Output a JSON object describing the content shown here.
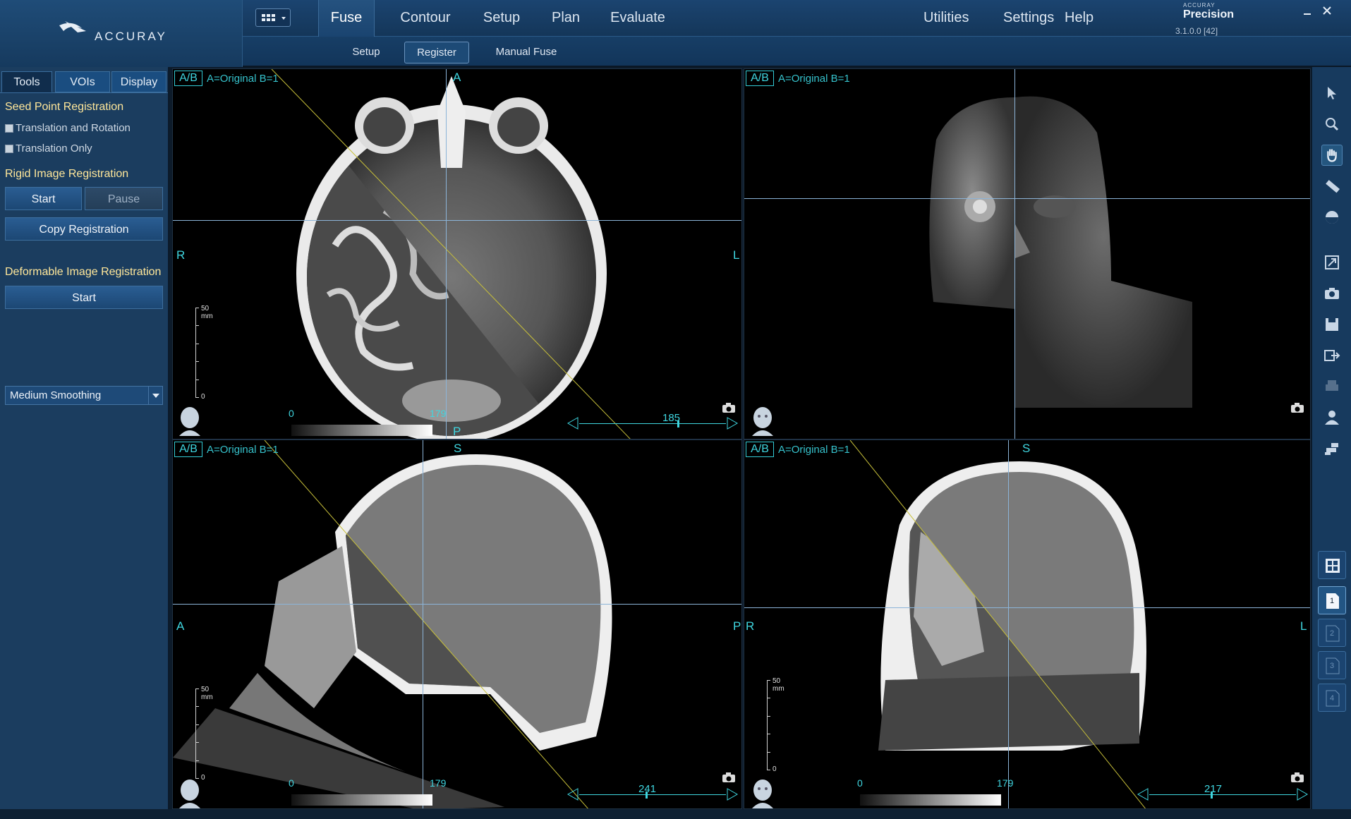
{
  "brand": {
    "logo_text": "ACCURAY",
    "small": "ACCURAY",
    "product": "Precision",
    "version": "3.1.0.0 [42]"
  },
  "main_tabs": [
    "Fuse",
    "Contour",
    "Setup",
    "Plan",
    "Evaluate"
  ],
  "util_tabs": [
    "Utilities",
    "Settings",
    "Help"
  ],
  "sub_tabs": [
    "Setup",
    "Register",
    "Manual Fuse"
  ],
  "left_panel": {
    "tabs": [
      "Tools",
      "VOIs",
      "Display"
    ],
    "seed_title": "Seed Point Registration",
    "check_translation_rotation": "Translation and Rotation",
    "check_translation_only": "Translation Only",
    "rigid_title": "Rigid Image Registration",
    "start_label": "Start",
    "pause_label": "Pause",
    "copy_label": "Copy Registration",
    "deformable_title": "Deformable Image Registration",
    "deformable_start_label": "Start",
    "smoothing_value": "Medium Smoothing"
  },
  "viewports": {
    "axial": {
      "ab": "A/B",
      "label": "A=Original B=1",
      "top": "A",
      "bottom": "P",
      "left": "R",
      "right": "L",
      "scale_label": "50 mm",
      "scale_zero": "0",
      "window_min": "0",
      "window_max": "179",
      "slice": "185",
      "slice_fraction": 0.67
    },
    "volume": {
      "ab": "A/B",
      "label": "A=Original B=1"
    },
    "sagittal": {
      "ab": "A/B",
      "label": "A=Original B=1",
      "top": "S",
      "left": "A",
      "right": "P",
      "scale_label": "50 mm",
      "scale_zero": "0",
      "window_min": "0",
      "window_max": "179",
      "slice": "241",
      "slice_fraction": 0.45
    },
    "coronal": {
      "ab": "A/B",
      "label": "A=Original B=1",
      "top": "S",
      "left": "R",
      "right": "L",
      "scale_label": "50 mm",
      "scale_zero": "0",
      "window_min": "0",
      "window_max": "179",
      "slice": "217",
      "slice_fraction": 0.42
    }
  },
  "page_buttons": [
    "1",
    "2",
    "3",
    "4"
  ],
  "icons": [
    "pointer-icon",
    "zoom-icon",
    "pan-icon",
    "ruler-icon",
    "window-level-icon",
    "fit-icon",
    "camera-icon",
    "save-icon",
    "export-icon",
    "print-icon",
    "user-icon",
    "robot-icon",
    "layout-grid-icon"
  ],
  "colors": {
    "accent": "#3fd6e0",
    "title": "#ffe79a",
    "background": "#1b3d5f"
  }
}
